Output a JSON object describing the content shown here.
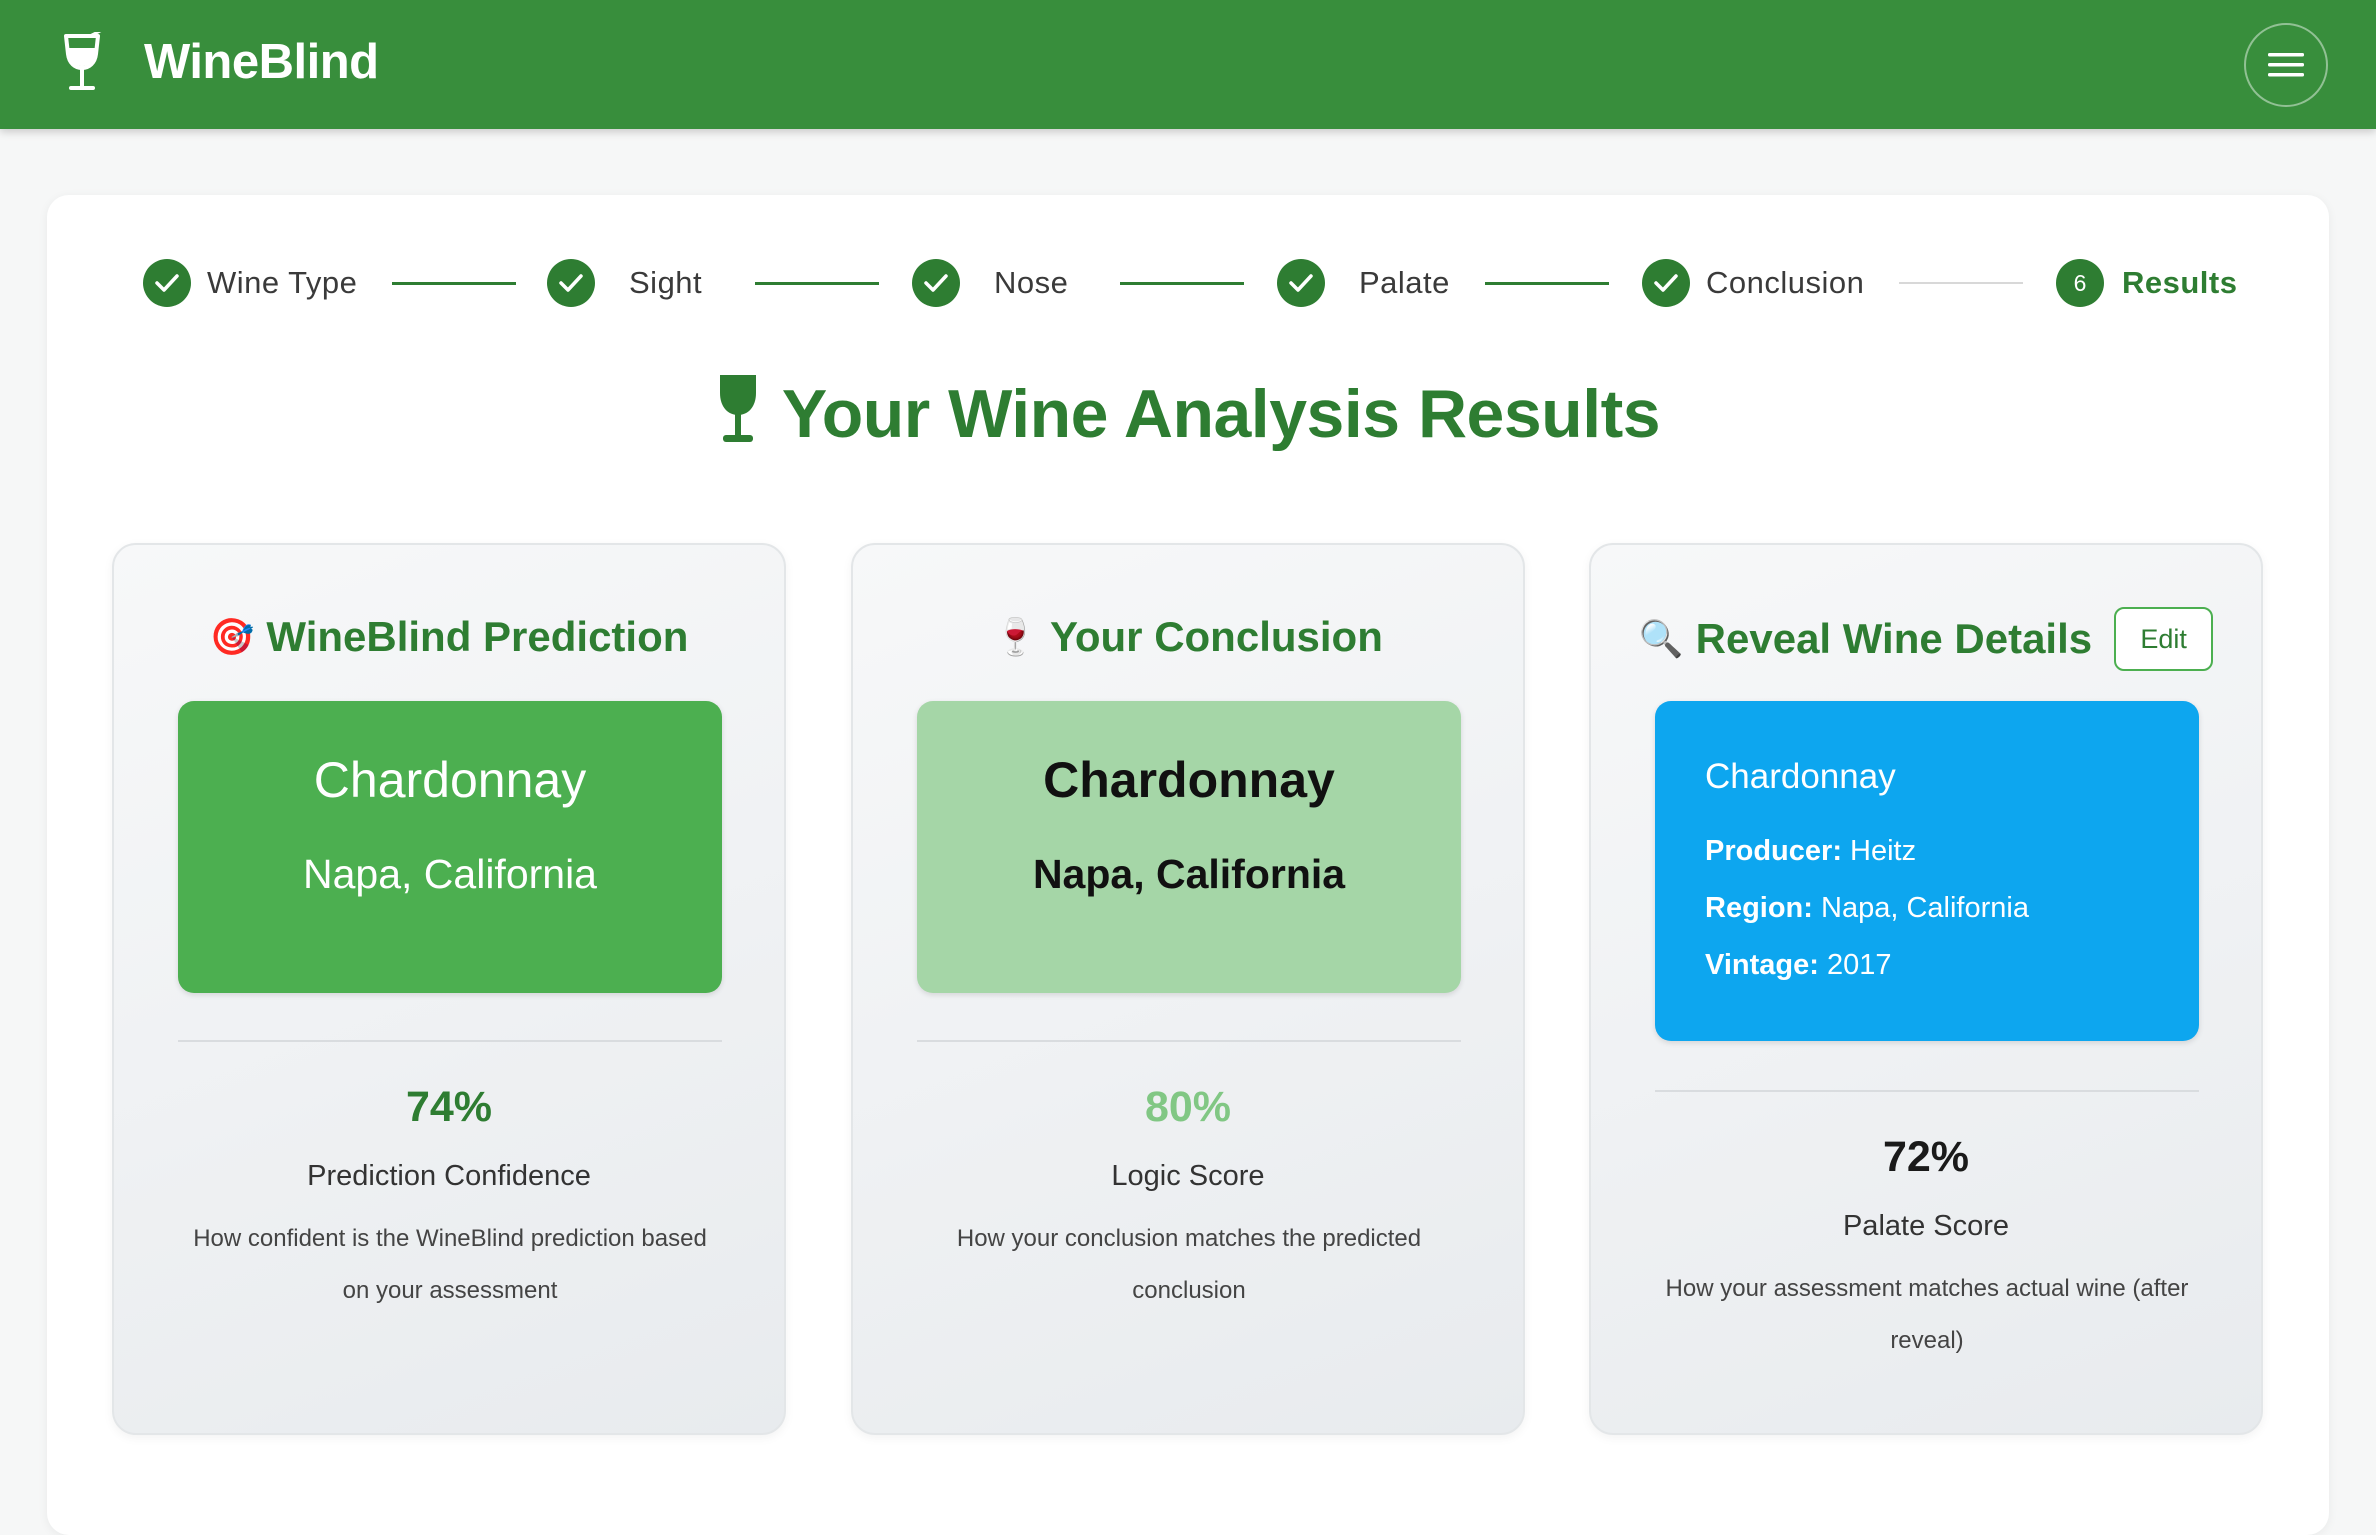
{
  "app": {
    "name": "WineBlind"
  },
  "stepper": [
    {
      "label": "Wine Type",
      "state": "done"
    },
    {
      "label": "Sight",
      "state": "done"
    },
    {
      "label": "Nose",
      "state": "done"
    },
    {
      "label": "Palate",
      "state": "done"
    },
    {
      "label": "Conclusion",
      "state": "done"
    },
    {
      "label": "Results",
      "number": "6",
      "state": "active"
    }
  ],
  "title": "Your Wine Analysis Results",
  "prediction": {
    "heading": "WineBlind Prediction",
    "emoji": "🎯",
    "grape": "Chardonnay",
    "region": "Napa, California",
    "score": "74%",
    "score_label": "Prediction Confidence",
    "score_desc": "How confident is the WineBlind prediction based on your assessment"
  },
  "conclusion": {
    "heading": "Your Conclusion",
    "emoji": "🍷",
    "grape": "Chardonnay",
    "region": "Napa, California",
    "score": "80%",
    "score_label": "Logic Score",
    "score_desc": "How your conclusion matches the predicted conclusion"
  },
  "reveal": {
    "heading": "Reveal Wine Details",
    "emoji": "🔍",
    "edit_label": "Edit",
    "grape": "Chardonnay",
    "producer_label": "Producer:",
    "producer": "Heitz",
    "region_label": "Region:",
    "region": "Napa, California",
    "vintage_label": "Vintage:",
    "vintage": "2017",
    "score": "72%",
    "score_label": "Palate Score",
    "score_desc": "How your assessment matches actual wine (after reveal)"
  },
  "colors": {
    "header": "#388e3c",
    "brand_green": "#2e7d32",
    "prediction_box": "#4caf50",
    "conclusion_box": "#a5d6a7",
    "reveal_box": "#0da6ef",
    "conclusion_score": "#81c784"
  },
  "icons": {
    "brand": "wine-glass-icon",
    "menu": "hamburger-menu-icon",
    "step_done": "check-icon",
    "title": "wine-glass-icon"
  }
}
